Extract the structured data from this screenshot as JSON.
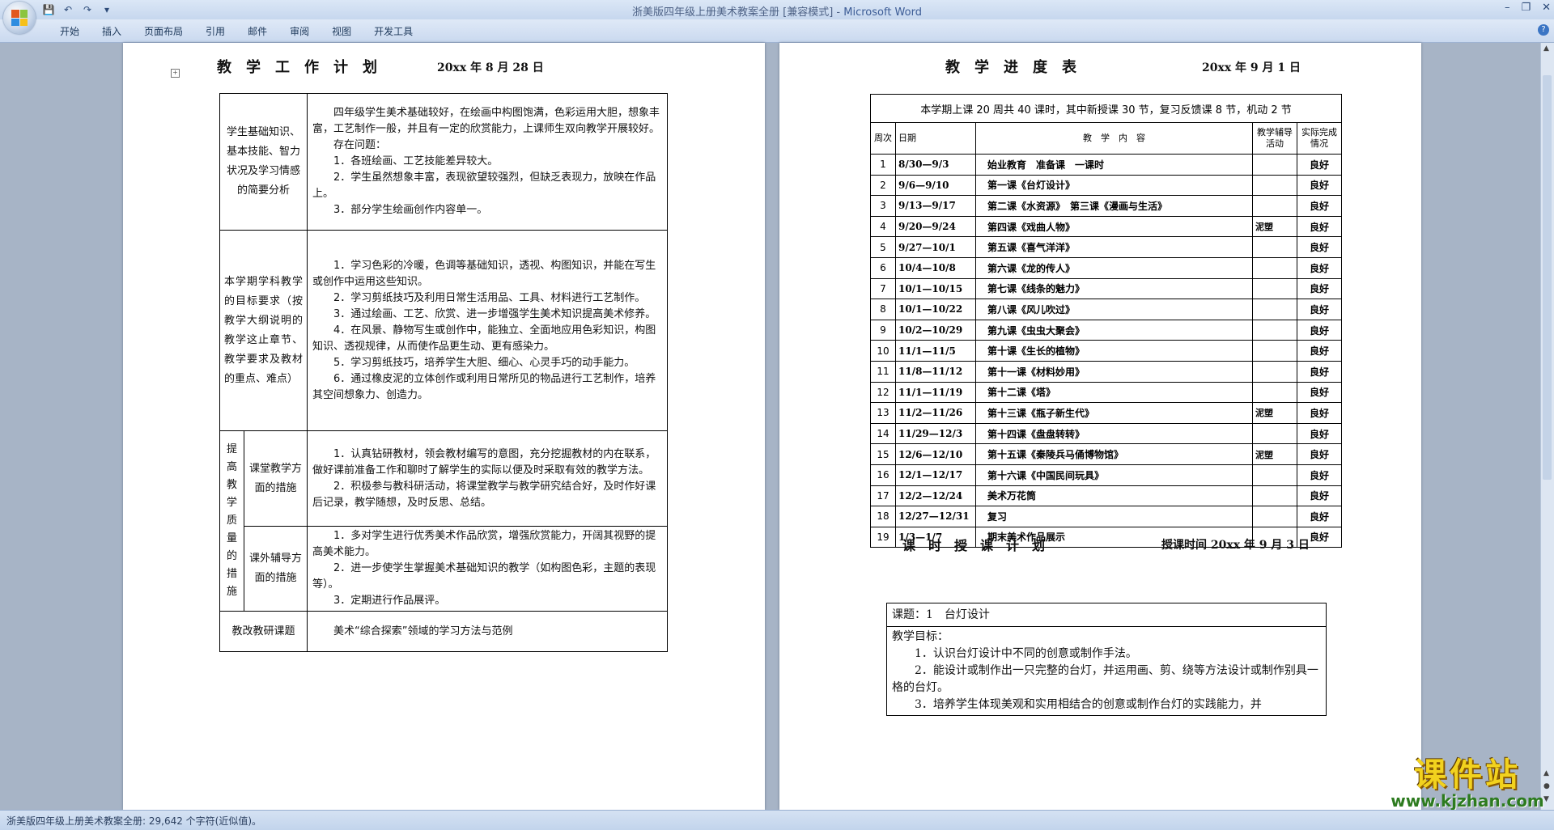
{
  "window": {
    "title": "浙美版四年级上册美术教案全册 [兼容模式]",
    "title_separator": " - ",
    "app_name": "Microsoft Word"
  },
  "menu": [
    "开始",
    "插入",
    "页面布局",
    "引用",
    "邮件",
    "审阅",
    "视图",
    "开发工具"
  ],
  "status": {
    "text": "浙美版四年级上册美术教案全册: 29,642 个字符(近似值)。"
  },
  "left_page": {
    "title": "教　学　工　作　计　划",
    "date": "20xx 年 8 月 28 日",
    "rows": [
      {
        "label": "学生基础知识、基本技能、智力状况及学习情感的简要分析",
        "lines": [
          "四年级学生美术基础较好，在绘画中构图饱满，色彩运用大胆，想象丰富，工艺制作一般，并且有一定的欣赏能力，上课师生双向教学开展较好。",
          "存在问题：",
          "1．各班绘画、工艺技能差异较大。",
          "2．学生虽然想象丰富，表现欲望较强烈，但缺乏表现力，放映在作品上。",
          "3．部分学生绘画创作内容单一。"
        ]
      },
      {
        "label": "本学期学科教学的目标要求（按教学大纲说明的教学这止章节、教学要求及教材的重点、难点）",
        "lines": [
          "1．学习色彩的冷暖，色调等基础知识，透视、构图知识，并能在写生或创作中运用这些知识。",
          "2．学习剪纸技巧及利用日常生活用品、工具、材料进行工艺制作。",
          "3．通过绘画、工艺、欣赏、进一步增强学生美术知识提高美术修养。",
          "4．在风景、静物写生或创作中，能独立、全面地应用色彩知识，构图知识、透视规律，从而使作品更生动、更有感染力。",
          "5．学习剪纸技巧，培养学生大胆、细心、心灵手巧的动手能力。",
          "6．通过橡皮泥的立体创作或利用日常所见的物品进行工艺制作，培养其空间想象力、创造力。"
        ]
      }
    ],
    "measures_label": "提高教学质量的措施",
    "measures": [
      {
        "label": "课堂教学方面的措施",
        "lines": [
          "1．认真钻研教材，领会教材编写的意图，充分挖掘教材的内在联系，做好课前准备工作和聊时了解学生的实际以便及时采取有效的教学方法。",
          "2．积极参与教科研活动，将课堂教学与教学研究结合好，及时作好课后记录，教学随想，及时反思、总结。"
        ]
      },
      {
        "label": "课外辅导方面的措施",
        "lines": [
          "1．多对学生进行优秀美术作品欣赏，增强欣赏能力，开阔其视野的提高美术能力。",
          "2．进一步使学生掌握美术基础知识的教学（如构图色彩，主题的表现等）。",
          "3．定期进行作品展评。"
        ]
      }
    ],
    "research": {
      "label": "教改教研课题",
      "text": "美术“综合探索”领域的学习方法与范例"
    }
  },
  "right_page": {
    "title": "教　学　进　度　表",
    "date": "20xx 年 9 月 1 日",
    "summary": "本学期上课 20 周共 40 课时，其中新授课 30 节，复习反馈课 8 节，机动  2 节",
    "headers": {
      "week": "周次",
      "date": "日期",
      "content": "教　学　内　容",
      "aux": "教学辅导活动",
      "result": "实际完成情况"
    },
    "rows": [
      {
        "week": "1",
        "date": "8/30—9/3",
        "content": "始业教育　准备课　一课时",
        "aux": "",
        "result": "良好"
      },
      {
        "week": "2",
        "date": "9/6—9/10",
        "content": "第一课《台灯设计》",
        "aux": "",
        "result": "良好"
      },
      {
        "week": "3",
        "date": "9/13—9/17",
        "content": "第二课《水资源》　第三课《漫画与生活》",
        "aux": "",
        "result": "良好"
      },
      {
        "week": "4",
        "date": "9/20—9/24",
        "content": "第四课《戏曲人物》",
        "aux": "泥塑",
        "result": "良好"
      },
      {
        "week": "5",
        "date": "9/27—10/1",
        "content": "第五课《喜气洋洋》",
        "aux": "",
        "result": "良好"
      },
      {
        "week": "6",
        "date": "10/4—10/8",
        "content": "第六课《龙的传人》",
        "aux": "",
        "result": "良好"
      },
      {
        "week": "7",
        "date": "10/1—10/15",
        "content": "第七课《线条的魅力》",
        "aux": "",
        "result": "良好"
      },
      {
        "week": "8",
        "date": "10/1—10/22",
        "content": "第八课《风儿吹过》",
        "aux": "",
        "result": "良好"
      },
      {
        "week": "9",
        "date": "10/2—10/29",
        "content": "第九课《虫虫大聚会》",
        "aux": "",
        "result": "良好"
      },
      {
        "week": "10",
        "date": "11/1—11/5",
        "content": "第十课《生长的植物》",
        "aux": "",
        "result": "良好"
      },
      {
        "week": "11",
        "date": "11/8—11/12",
        "content": "第十一课《材料妙用》",
        "aux": "",
        "result": "良好"
      },
      {
        "week": "12",
        "date": "11/1—11/19",
        "content": "第十二课《塔》",
        "aux": "",
        "result": "良好"
      },
      {
        "week": "13",
        "date": "11/2—11/26",
        "content": "第十三课《瓶子新生代》",
        "aux": "泥塑",
        "result": "良好"
      },
      {
        "week": "14",
        "date": "11/29—12/3",
        "content": "第十四课《盘盘转转》",
        "aux": "",
        "result": "良好"
      },
      {
        "week": "15",
        "date": "12/6—12/10",
        "content": "第十五课《秦陵兵马俑博物馆》",
        "aux": "泥塑",
        "result": "良好"
      },
      {
        "week": "16",
        "date": "12/1—12/17",
        "content": "第十六课《中国民间玩具》",
        "aux": "",
        "result": "良好"
      },
      {
        "week": "17",
        "date": "12/2—12/24",
        "content": "美术万花筒",
        "aux": "",
        "result": "良好"
      },
      {
        "week": "18",
        "date": "12/27—12/31",
        "content": "复习",
        "aux": "",
        "result": "良好"
      },
      {
        "week": "19",
        "date": "1/3—1/7",
        "content": "期末美术作品展示",
        "aux": "",
        "result": "良好"
      }
    ],
    "lesson_title": "课　时　授　课　计　划",
    "lesson_date": "授课时间 20xx 年 9 月 3 日",
    "lesson_topic": "课题：1　台灯设计",
    "lesson_goal_label": "教学目标：",
    "lesson_goals": [
      "1．认识台灯设计中不同的创意或制作手法。",
      "2．能设计或制作出一只完整的台灯，并运用画、剪、绕等方法设计或制作别具一格的台灯。",
      "3．培养学生体现美观和实用相结合的创意或制作台灯的实践能力，并"
    ]
  },
  "watermark": {
    "big": "课件站",
    "url": "www.kjzhan.com"
  }
}
